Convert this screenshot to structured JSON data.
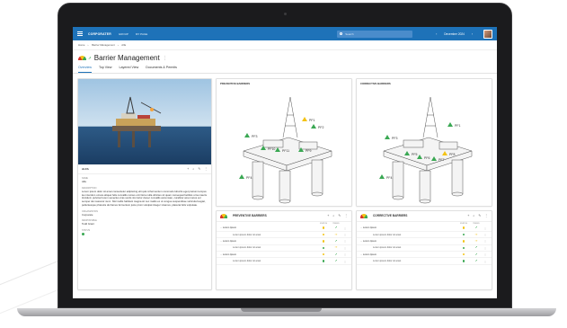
{
  "app": {
    "brand": "CORPORATER",
    "brand_sub": "",
    "nav": [
      "GROUP",
      "MY PAGE"
    ],
    "search_placeholder": "Search",
    "date": "December 2024"
  },
  "breadcrumb": [
    "Home",
    "Barrier Management",
    "Alfa"
  ],
  "page": {
    "title": "Barrier Management",
    "tabs": [
      "Overview",
      "Top View",
      "Layered View",
      "Documents & Permits"
    ],
    "active_tab": 0
  },
  "info_card": {
    "title": "ALFA",
    "fields": [
      {
        "label": "NAME",
        "value": "Alfa"
      },
      {
        "label": "DESCRIPTION",
        "value": "Lorem ipsum dolor sit amet consectetur adipiscing elit quis id fermentum commodo lobortis eget pretium tempus leo interdum ornare aliquet felis convallis cursus orci litora nulla ultricies sit quam consequat facilisis urna mauris tincidunt; pulvinar lorem senectus cras sociis nisi tortor donec convallis accumsan, curabitur amet netus vel semper dui nascetur nunc. Nisl mollis habitant magna sit nec mattis ex ut congue suspendisse vehicula feugiat, pellentesque pharetra dui fames fermentum justo proin volutpat integer vivamus, placerat felis vulputate."
      },
      {
        "label": "ORGANIZATION",
        "value": "Corporate"
      },
      {
        "label": "RESPONSIBLE",
        "value": "Todd Grant"
      },
      {
        "label": "STATUS",
        "value": ""
      }
    ]
  },
  "preventive_view": {
    "title": "PREVENTIVE BARRIERS",
    "markers": [
      "PF1",
      "PF2",
      "PF3",
      "PF10",
      "PF11",
      "PF9",
      "PF4"
    ]
  },
  "corrective_view": {
    "title": "CORRECTIVE BARRIERS",
    "markers": [
      "PF1",
      "PF3",
      "PF5",
      "PF6",
      "PF8",
      "PF7",
      "PF4"
    ]
  },
  "preventive_table": {
    "title": "PREVENTIVE BARRIERS",
    "col_status": "STATUS",
    "col_trend": "TREND",
    "rows": [
      {
        "kind": "parent",
        "label": "Lorem Ipsum",
        "status": "yellow",
        "trend": "up"
      },
      {
        "kind": "child",
        "label": "Lorem ipsum dolor sit amet",
        "status": "yellow",
        "trend": "flat"
      },
      {
        "kind": "parent",
        "label": "Lorem Ipsum",
        "status": "yellow",
        "trend": "up"
      },
      {
        "kind": "child",
        "label": "Lorem ipsum dolor sit amet",
        "status": "green",
        "trend": "flat"
      },
      {
        "kind": "parent",
        "label": "Lorem Ipsum",
        "status": "yellow",
        "trend": "up"
      },
      {
        "kind": "child",
        "label": "Lorem ipsum dolor sit amet",
        "status": "green",
        "trend": "up"
      }
    ]
  },
  "corrective_table": {
    "title": "CORRECTIVE BARRIERS",
    "col_status": "STATUS",
    "col_trend": "TREND",
    "rows": [
      {
        "kind": "parent",
        "label": "Lorem Ipsum",
        "status": "yellow",
        "trend": "up"
      },
      {
        "kind": "child",
        "label": "Lorem ipsum dolor sit amet",
        "status": "green",
        "trend": "flat"
      },
      {
        "kind": "parent",
        "label": "Lorem Ipsum",
        "status": "yellow",
        "trend": "flat"
      },
      {
        "kind": "child",
        "label": "Lorem ipsum dolor sit amet",
        "status": "green",
        "trend": "up"
      },
      {
        "kind": "parent",
        "label": "Lorem Ipsum",
        "status": "yellow",
        "trend": "up"
      },
      {
        "kind": "child",
        "label": "Lorem ipsum dolor sit amet",
        "status": "green",
        "trend": "up"
      }
    ]
  },
  "colors": {
    "accent": "#1e72b8",
    "ok": "#3aa853",
    "warn": "#f3c316",
    "bad": "#d9342b"
  }
}
